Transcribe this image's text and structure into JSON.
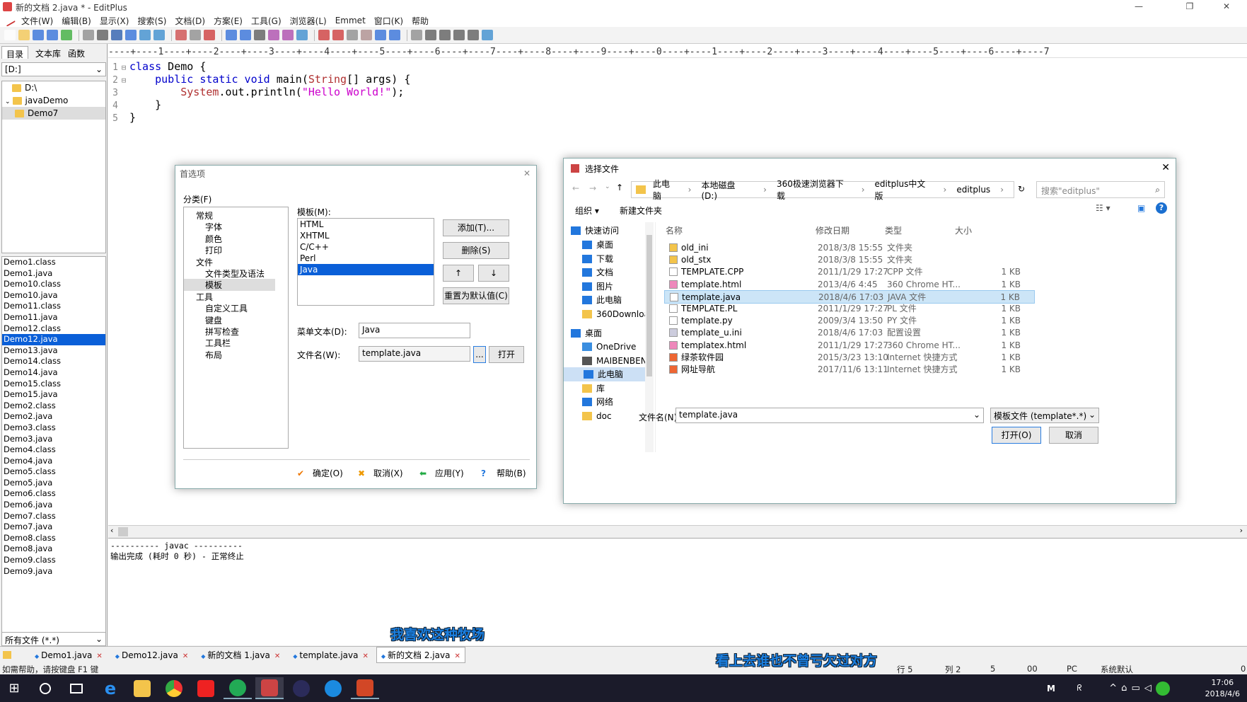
{
  "window": {
    "title": "新的文档 2.java * - EditPlus"
  },
  "menu": [
    "文件(W)",
    "编辑(B)",
    "显示(X)",
    "搜索(S)",
    "文档(D)",
    "方案(E)",
    "工具(G)",
    "浏览器(L)",
    "Emmet",
    "窗口(K)",
    "帮助"
  ],
  "left": {
    "tabs": [
      "目录",
      "文本库",
      "函数"
    ],
    "drive": "[D:]",
    "tree": [
      "D:\\",
      "javaDemo",
      "Demo7"
    ],
    "files": [
      "Demo1.class",
      "Demo1.java",
      "Demo10.class",
      "Demo10.java",
      "Demo11.class",
      "Demo11.java",
      "Demo12.class",
      "Demo12.java",
      "Demo13.java",
      "Demo14.class",
      "Demo14.java",
      "Demo15.class",
      "Demo15.java",
      "Demo2.class",
      "Demo2.java",
      "Demo3.class",
      "Demo3.java",
      "Demo4.class",
      "Demo4.java",
      "Demo5.class",
      "Demo5.java",
      "Demo6.class",
      "Demo6.java",
      "Demo7.class",
      "Demo7.java",
      "Demo8.class",
      "Demo8.java",
      "Demo9.class",
      "Demo9.java"
    ],
    "selected_file": "Demo12.java",
    "filter": "所有文件 (*.*)"
  },
  "editor": {
    "ruler": "----+----1----+----2----+----3----+----4----+----5----+----6----+----7----+----8----+----9----+----0----+----1----+----2----+----3----+----4----+----5----+----6----+----7",
    "lines": [
      {
        "n": "1",
        "fold": "⊟",
        "parts": [
          [
            "kw",
            "class"
          ],
          [
            "t",
            " Demo {"
          ]
        ]
      },
      {
        "n": "2",
        "fold": "⊟",
        "parts": [
          [
            "t",
            "    "
          ],
          [
            "kw",
            "public static void"
          ],
          [
            "t",
            " main("
          ],
          [
            "cls",
            "String"
          ],
          [
            "t",
            "[] args) {"
          ]
        ]
      },
      {
        "n": "3",
        "fold": "",
        "parts": [
          [
            "t",
            "        "
          ],
          [
            "cls",
            "System"
          ],
          [
            "t",
            ".out.println("
          ],
          [
            "str",
            "\"Hello World!\""
          ],
          [
            "t",
            ");"
          ]
        ]
      },
      {
        "n": "4",
        "fold": "",
        "parts": [
          [
            "t",
            "    }"
          ]
        ]
      },
      {
        "n": "5",
        "fold": "",
        "parts": [
          [
            "t",
            "}"
          ]
        ]
      }
    ]
  },
  "output": {
    "line1": "---------- javac ----------",
    "line2": "输出完成 (耗时 0 秒) - 正常终止"
  },
  "doc_tabs": [
    {
      "label": "Demo1.java",
      "active": false
    },
    {
      "label": "Demo12.java",
      "active": false
    },
    {
      "label": "新的文档 1.java",
      "active": false
    },
    {
      "label": "template.java",
      "active": false
    },
    {
      "label": "新的文档 2.java",
      "active": true
    }
  ],
  "status": {
    "help": "如需帮助，请按键盘 F1 键",
    "row": "行 5",
    "col": "列 2",
    "v1": "5",
    "v2": "00",
    "mode": "PC",
    "enc": "系统默认",
    "v3": "0"
  },
  "subtitles": [
    "我喜欢这种牧场",
    "看上去谁也不曾亏欠过对方"
  ],
  "pref": {
    "title": "首选项",
    "category_label": "分类(F)",
    "categories": [
      {
        "t": "常规",
        "l": 0
      },
      {
        "t": "字体",
        "l": 1
      },
      {
        "t": "颜色",
        "l": 1
      },
      {
        "t": "打印",
        "l": 1
      },
      {
        "t": "文件",
        "l": 0
      },
      {
        "t": "文件类型及语法",
        "l": 1
      },
      {
        "t": "模板",
        "l": 1
      },
      {
        "t": "工具",
        "l": 0
      },
      {
        "t": "自定义工具",
        "l": 1
      },
      {
        "t": "键盘",
        "l": 1
      },
      {
        "t": "拼写检查",
        "l": 1
      },
      {
        "t": "工具栏",
        "l": 1
      },
      {
        "t": "布局",
        "l": 1
      }
    ],
    "template_label": "模板(M):",
    "templates": [
      "HTML",
      "XHTML",
      "C/C++",
      "Perl",
      "Java"
    ],
    "selected_template": "Java",
    "add": "添加(T)...",
    "delete": "删除(S)",
    "up": "↑",
    "down": "↓",
    "reset": "重置为默认值(C)",
    "menu_text_label": "菜单文本(D):",
    "menu_text": "Java",
    "filename_label": "文件名(W):",
    "filename": "template.java",
    "browse": "...",
    "open": "打开",
    "ok": "确定(O)",
    "cancel": "取消(X)",
    "apply": "应用(Y)",
    "help": "帮助(B)"
  },
  "filedlg": {
    "title": "选择文件",
    "crumbs": [
      "此电脑",
      "本地磁盘 (D:)",
      "360极速浏览器下载",
      "editplus中文版",
      "editplus"
    ],
    "search": "搜索\"editplus\"",
    "organize": "组织 ▾",
    "newfolder": "新建文件夹",
    "nav": [
      "快速访问",
      "桌面",
      "下载",
      "文档",
      "图片",
      "此电脑",
      "360Downloa",
      "桌面",
      "OneDrive",
      "MAIBENBEN",
      "此电脑",
      "库",
      "网络",
      "doc"
    ],
    "cols": [
      "名称",
      "修改日期",
      "类型",
      "大小"
    ],
    "files": [
      {
        "name": "old_ini",
        "date": "2018/3/8 15:55",
        "type": "文件夹",
        "size": "",
        "icon": "folder"
      },
      {
        "name": "old_stx",
        "date": "2018/3/8 15:55",
        "type": "文件夹",
        "size": "",
        "icon": "folder"
      },
      {
        "name": "TEMPLATE.CPP",
        "date": "2011/1/29 17:27",
        "type": "CPP 文件",
        "size": "1 KB",
        "icon": "file"
      },
      {
        "name": "template.html",
        "date": "2013/4/6 4:45",
        "type": "360 Chrome HT...",
        "size": "1 KB",
        "icon": "chrome"
      },
      {
        "name": "template.java",
        "date": "2018/4/6 17:03",
        "type": "JAVA 文件",
        "size": "1 KB",
        "icon": "file"
      },
      {
        "name": "TEMPLATE.PL",
        "date": "2011/1/29 17:27",
        "type": "PL 文件",
        "size": "1 KB",
        "icon": "file"
      },
      {
        "name": "template.py",
        "date": "2009/3/4 13:50",
        "type": "PY 文件",
        "size": "1 KB",
        "icon": "file"
      },
      {
        "name": "template_u.ini",
        "date": "2018/4/6 17:03",
        "type": "配置设置",
        "size": "1 KB",
        "icon": "ini"
      },
      {
        "name": "templatex.html",
        "date": "2011/1/29 17:27",
        "type": "360 Chrome HT...",
        "size": "1 KB",
        "icon": "chrome"
      },
      {
        "name": "绿茶软件园",
        "date": "2015/3/23 13:10",
        "type": "Internet 快捷方式",
        "size": "1 KB",
        "icon": "url"
      },
      {
        "name": "网址导航",
        "date": "2017/11/6 13:11",
        "type": "Internet 快捷方式",
        "size": "1 KB",
        "icon": "url"
      }
    ],
    "selected": "template.java",
    "filename_label": "文件名(N):",
    "filename": "template.java",
    "filter": "模板文件 (template*.*)",
    "open": "打开(O)",
    "cancel": "取消"
  },
  "taskbar": {
    "time": "17:06",
    "date": "2018/4/6"
  }
}
